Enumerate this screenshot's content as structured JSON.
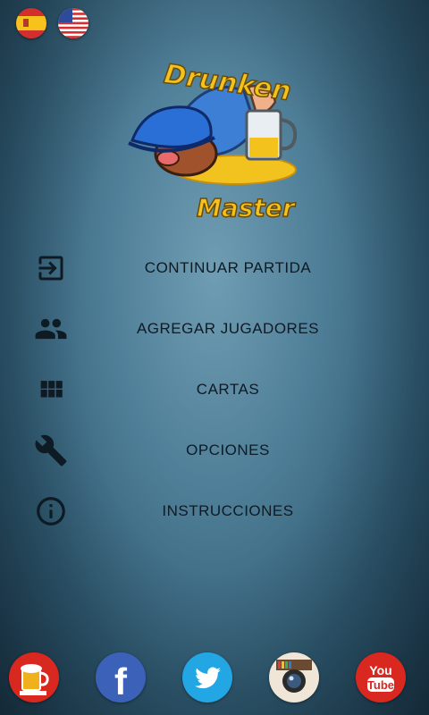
{
  "languages": [
    {
      "name": "spanish",
      "icon": "spain-flag-icon"
    },
    {
      "name": "english",
      "icon": "usa-flag-icon"
    }
  ],
  "logo": {
    "line1": "Drunken",
    "line2": "Master"
  },
  "menu": {
    "items": [
      {
        "label": "CONTINUAR PARTIDA",
        "icon": "login-icon"
      },
      {
        "label": "AGREGAR JUGADORES",
        "icon": "people-icon"
      },
      {
        "label": "CARTAS",
        "icon": "grid-icon"
      },
      {
        "label": "OPCIONES",
        "icon": "wrench-icon"
      },
      {
        "label": "INSTRUCCIONES",
        "icon": "info-icon"
      }
    ]
  },
  "social": {
    "youtube_label": "You\nTube",
    "facebook_letter": "f"
  },
  "colors": {
    "facebook": "#3b62b8",
    "twitter": "#23a7e4",
    "youtube": "#d9281f",
    "beer": "#e8b020"
  }
}
